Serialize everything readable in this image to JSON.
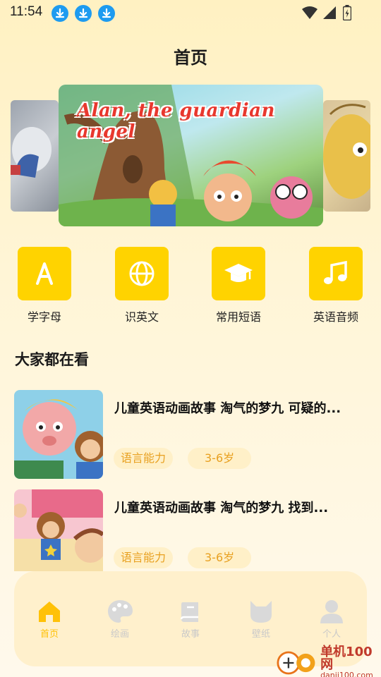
{
  "status_bar": {
    "time": "11:54"
  },
  "page": {
    "title": "首页"
  },
  "banner": {
    "title": "Alan, the guardian angel"
  },
  "categories": [
    {
      "label": "学字母",
      "icon": "letter-a-icon"
    },
    {
      "label": "识英文",
      "icon": "globe-icon"
    },
    {
      "label": "常用短语",
      "icon": "graduation-cap-icon"
    },
    {
      "label": "英语音频",
      "icon": "music-note-icon"
    }
  ],
  "section": {
    "title": "大家都在看"
  },
  "list": [
    {
      "title": "儿童英语动画故事 淘气的梦九 可疑的...",
      "tags": [
        "语言能力",
        "3-6岁"
      ]
    },
    {
      "title": "儿童英语动画故事 淘气的梦九 找到...",
      "tags": [
        "语言能力",
        "3-6岁"
      ]
    }
  ],
  "nav": [
    {
      "label": "首页",
      "icon": "home-icon",
      "active": true
    },
    {
      "label": "绘画",
      "icon": "palette-icon",
      "active": false
    },
    {
      "label": "故事",
      "icon": "book-icon",
      "active": false
    },
    {
      "label": "壁纸",
      "icon": "cat-face-icon",
      "active": false
    },
    {
      "label": "个人",
      "icon": "person-icon",
      "active": false
    }
  ],
  "colors": {
    "accent": "#FFD300",
    "tag_bg": "#FFF0C8",
    "tag_text": "#E8A020",
    "nav_active": "#FFC107",
    "nav_inactive": "#C9C9C9"
  },
  "watermark": {
    "name": "单机100网",
    "url": "danji100.com"
  }
}
